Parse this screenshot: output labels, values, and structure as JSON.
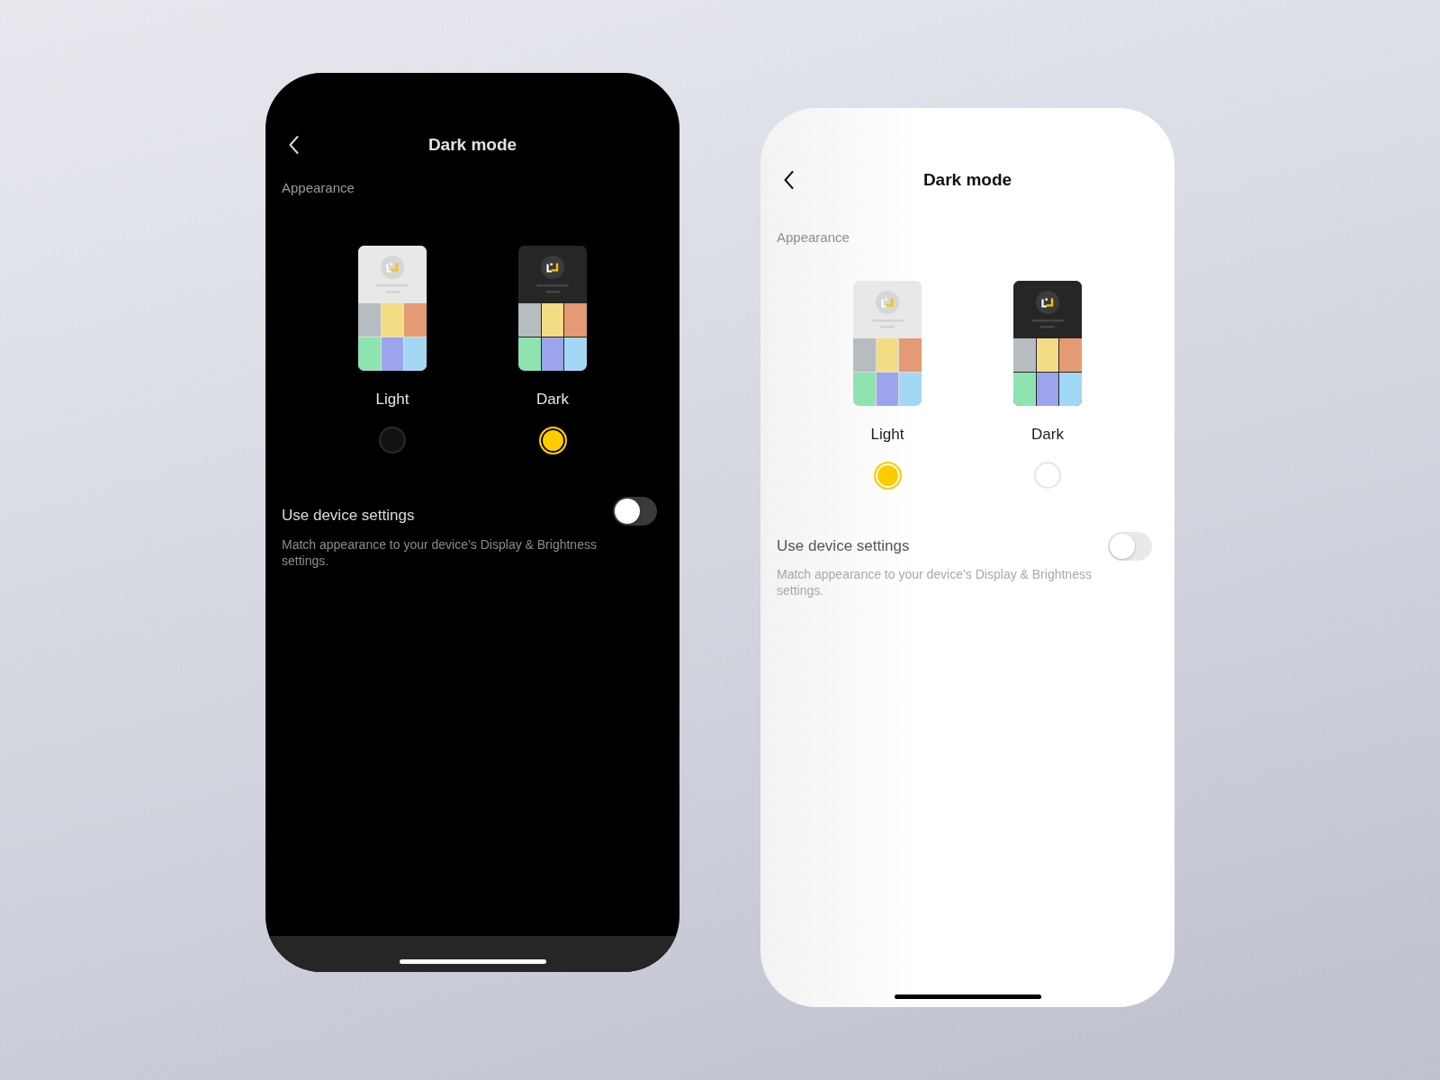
{
  "screens": [
    {
      "dark": true,
      "title": "Dark mode",
      "section_label": "Appearance",
      "options": [
        {
          "label": "Light",
          "kind": "light",
          "selected": false
        },
        {
          "label": "Dark",
          "kind": "dark",
          "selected": true
        }
      ],
      "device_setting": {
        "label": "Use device settings",
        "description": "Match appearance to your device’s Display & Brightness settings.",
        "on": false
      }
    },
    {
      "dark": false,
      "title": "Dark mode",
      "section_label": "Appearance",
      "options": [
        {
          "label": "Light",
          "kind": "light",
          "selected": true
        },
        {
          "label": "Dark",
          "kind": "dark",
          "selected": false
        }
      ],
      "device_setting": {
        "label": "Use device settings",
        "description": "Match appearance to your device’s Display & Brightness settings.",
        "on": false
      }
    }
  ]
}
